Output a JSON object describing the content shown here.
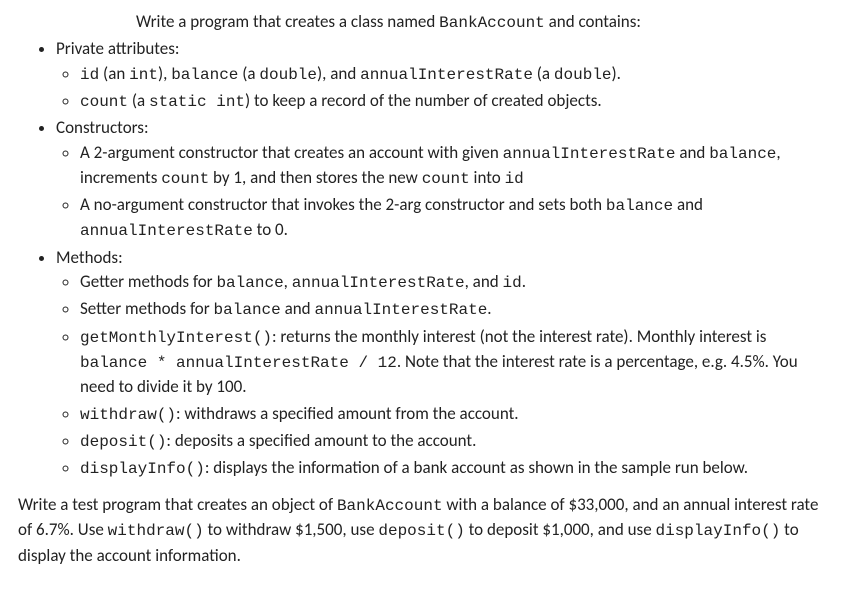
{
  "intro": {
    "p1a": "Write a program that creates a class named ",
    "p1b": "BankAccount",
    "p1c": " and contains:"
  },
  "sec1": {
    "title": "Private attributes:",
    "a": {
      "t1": "id",
      "t2": " (an ",
      "t3": "int",
      "t4": "), ",
      "t5": "balance",
      "t6": " (a ",
      "t7": "double",
      "t8": "), and ",
      "t9": "annualInterestRate",
      "t10": " (a ",
      "t11": "double",
      "t12": ")."
    },
    "b": {
      "t1": "count",
      "t2": " (a ",
      "t3": "static int",
      "t4": ") to keep a record of the number of created objects."
    }
  },
  "sec2": {
    "title": "Constructors:",
    "a": {
      "t1": "A 2-argument constructor that creates an account with given ",
      "t2": "annualInterestRate",
      "t3": " and ",
      "t4": "balance",
      "t5": ", increments ",
      "t6": "count",
      "t7": " by 1, and then stores the new ",
      "t8": "count",
      "t9": " into ",
      "t10": "id"
    },
    "b": {
      "t1": "A no-argument constructor that invokes the 2-arg constructor and sets both ",
      "t2": "balance",
      "t3": " and ",
      "t4": "annualInterestRate",
      "t5": " to 0."
    }
  },
  "sec3": {
    "title": "Methods:",
    "a": {
      "t1": "Getter methods for ",
      "t2": "balance",
      "t3": ", ",
      "t4": "annualInterestRate",
      "t5": ", and ",
      "t6": "id",
      "t7": "."
    },
    "b": {
      "t1": "Setter methods for ",
      "t2": "balance",
      "t3": " and ",
      "t4": "annualInterestRate",
      "t5": "."
    },
    "c": {
      "t1": "getMonthlyInterest()",
      "t2": ": returns the monthly interest (not the interest rate). Monthly interest is ",
      "t3": "balance * annualInterestRate / 12",
      "t4": ". Note that the interest rate is a percentage, e.g. 4.5%. You need to divide it by 100."
    },
    "d": {
      "t1": "withdraw()",
      "t2": ": withdraws a specified amount from the account."
    },
    "e": {
      "t1": "deposit()",
      "t2": ": deposits a specified amount to the account."
    },
    "f": {
      "t1": "displayInfo()",
      "t2": ": displays the information of a bank account as shown in the sample run below."
    }
  },
  "final": {
    "t1": "Write a test program that creates an object of ",
    "t2": "BankAccount",
    "t3": " with a balance of $33,000, and an annual interest rate of 6.7%. Use ",
    "t4": "withdraw()",
    "t5": " to withdraw $1,500, use ",
    "t6": "deposit()",
    "t7": " to deposit $1,000, and use ",
    "t8": "displayInfo()",
    "t9": " to display the account information."
  }
}
